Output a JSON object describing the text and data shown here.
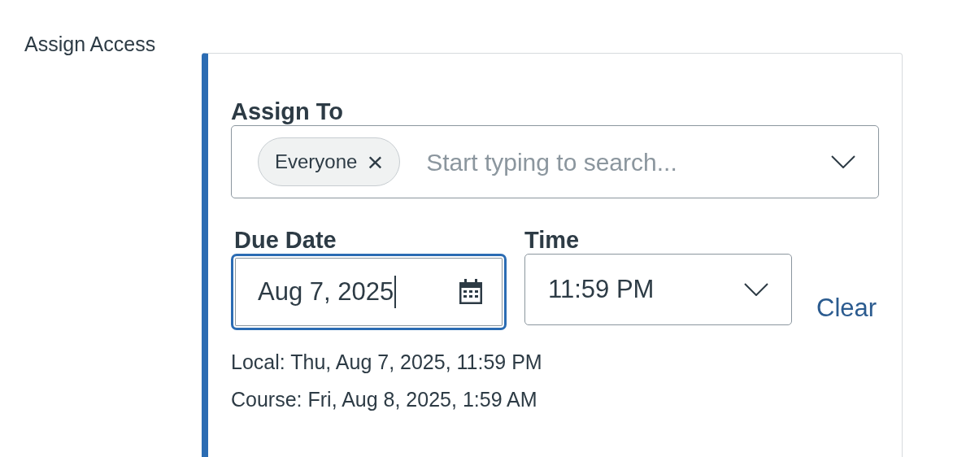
{
  "section_label": "Assign Access",
  "assign_to": {
    "label": "Assign To",
    "chips": [
      {
        "label": "Everyone",
        "remove": "×"
      }
    ],
    "placeholder": "Start typing to search..."
  },
  "due_date": {
    "label": "Due Date",
    "value": "Aug 7, 2025",
    "focused": true
  },
  "time": {
    "label": "Time",
    "value": "11:59 PM"
  },
  "clear_link": "Clear",
  "local_time": "Local: Thu, Aug 7, 2025, 11:59 PM",
  "course_time": "Course: Fri, Aug 8, 2025, 1:59 AM"
}
